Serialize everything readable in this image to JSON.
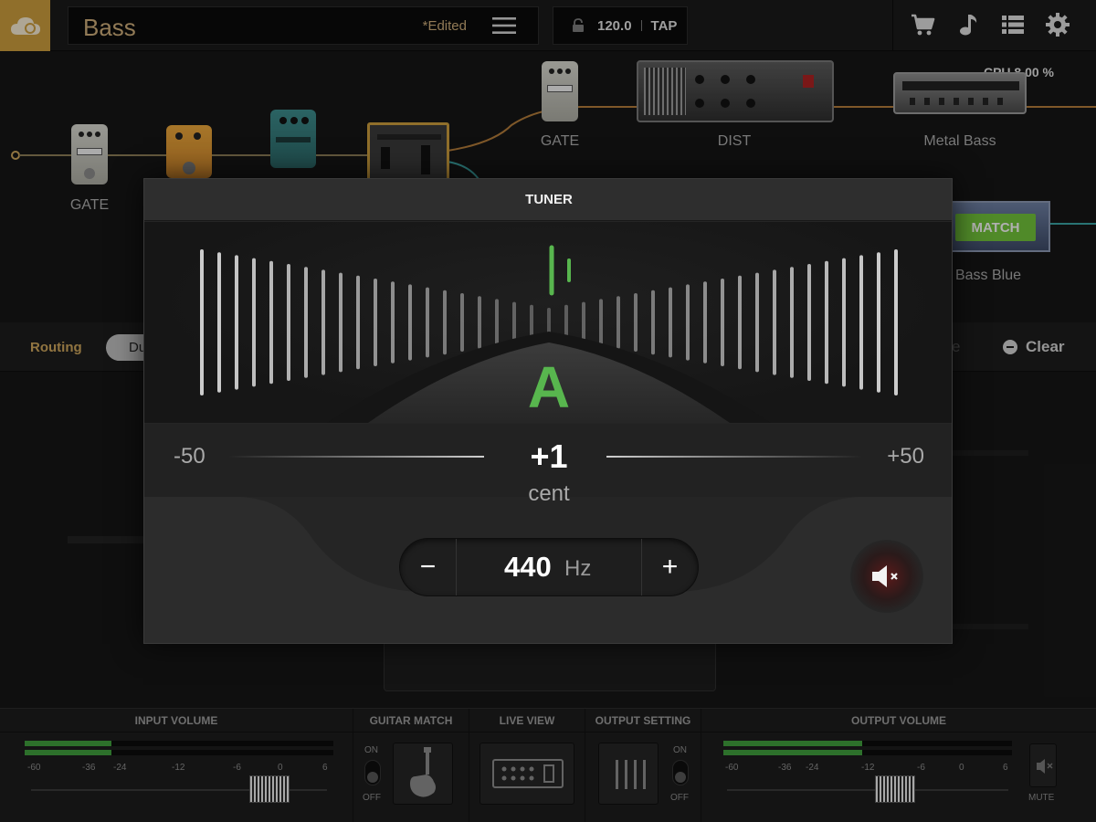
{
  "topbar": {
    "preset_name": "Bass",
    "edited_label": "*Edited",
    "bpm": "120.0",
    "tap_label": "TAP",
    "icons": [
      "cart-icon",
      "music-note-icon",
      "list-icon",
      "gear-icon"
    ]
  },
  "chain": {
    "cpu_label": "CPU 8.00 %",
    "nodes": {
      "gate_1": "GATE",
      "gate_2": "GATE",
      "dist": "DIST",
      "metal_bass": "Metal Bass",
      "bass_blue": "Bass Blue"
    },
    "match_label": "MATCH"
  },
  "routing": {
    "label": "Routing",
    "mode_partial": "Du",
    "faded_partial": "e",
    "clear_label": "Clear"
  },
  "tuner": {
    "title": "TUNER",
    "note": "A",
    "cents_min": "-50",
    "cents_max": "+50",
    "cents_value": "+1",
    "cents_unit": "cent",
    "freq_minus": "−",
    "freq_plus": "+",
    "freq_value": "440",
    "freq_unit": "Hz",
    "colors": {
      "in_tune": "#58b64e",
      "mute": "#e23a3a"
    }
  },
  "bottom": {
    "input_volume": {
      "title": "INPUT VOLUME",
      "scale": [
        "-60",
        "-36",
        "-24",
        "-12",
        "-6",
        "0",
        "6"
      ]
    },
    "guitar_match": {
      "title": "GUITAR MATCH",
      "on": "ON",
      "off": "OFF"
    },
    "live_view": {
      "title": "LIVE VIEW"
    },
    "output_setting": {
      "title": "OUTPUT SETTING",
      "on": "ON",
      "off": "OFF"
    },
    "output_volume": {
      "title": "OUTPUT VOLUME",
      "scale": [
        "-60",
        "-36",
        "-24",
        "-12",
        "-6",
        "0",
        "6"
      ],
      "mute_label": "MUTE"
    }
  }
}
